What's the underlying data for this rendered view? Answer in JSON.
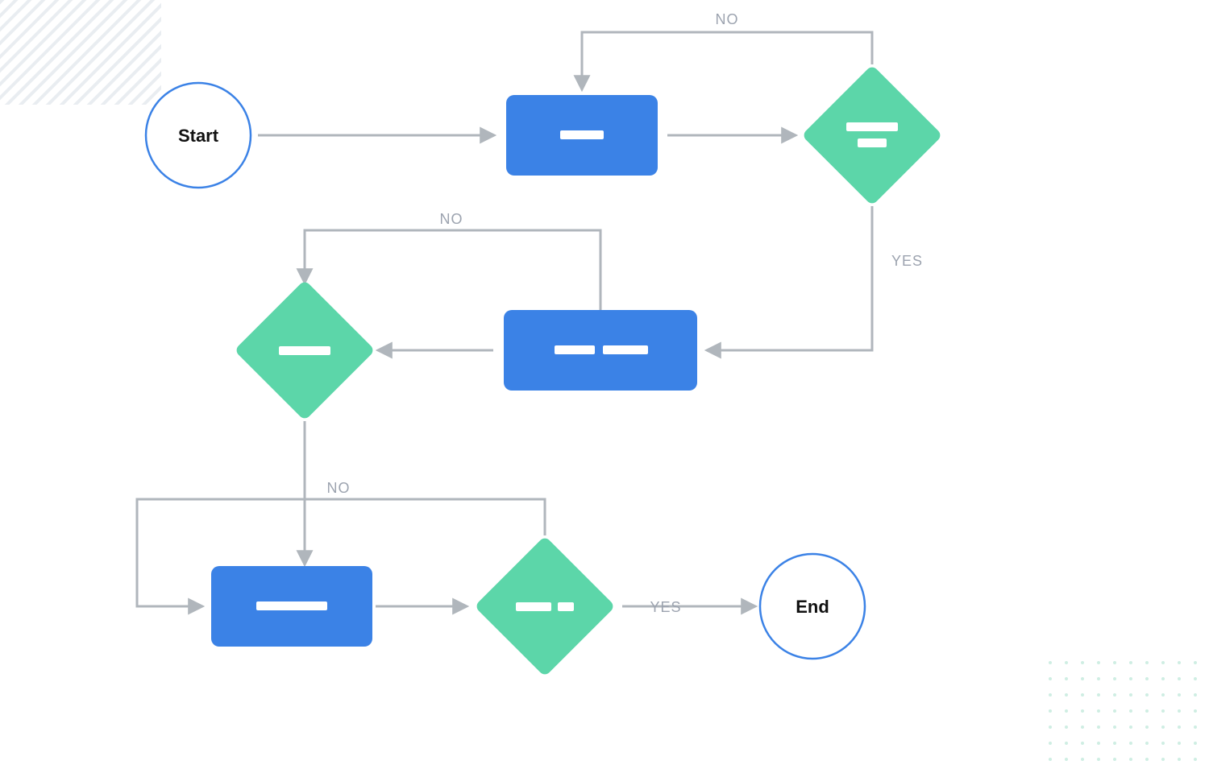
{
  "flowchart": {
    "nodes": {
      "start": {
        "label": "Start",
        "type": "terminator"
      },
      "p1": {
        "type": "process"
      },
      "d1": {
        "type": "decision"
      },
      "p2": {
        "type": "process"
      },
      "d2": {
        "type": "decision"
      },
      "p3": {
        "type": "process"
      },
      "d3": {
        "type": "decision"
      },
      "end": {
        "label": "End",
        "type": "terminator"
      }
    },
    "edges": {
      "d1_no": {
        "label": "NO"
      },
      "d1_yes": {
        "label": "YES"
      },
      "d2_no": {
        "label": "NO"
      },
      "d3_no": {
        "label": "NO"
      },
      "d3_yes": {
        "label": "YES"
      }
    },
    "colors": {
      "process": "#3b82e6",
      "decision": "#5cd6a9",
      "terminator_stroke": "#3b82e6",
      "arrow": "#b0b6bc",
      "label": "#9ca3af",
      "bar": "#ffffff"
    }
  }
}
